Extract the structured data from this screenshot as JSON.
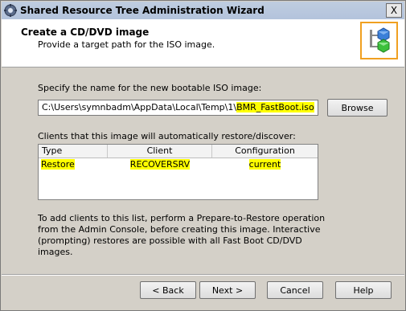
{
  "window": {
    "title": "Shared Resource Tree Administration Wizard",
    "close_label": "X"
  },
  "header": {
    "title": "Create a CD/DVD image",
    "subtitle": "Provide a target path for the ISO image."
  },
  "form": {
    "name_label": "Specify the name for the new bootable ISO image:",
    "path_prefix": "C:\\Users\\symnbadm\\AppData\\Local\\Temp\\1\\",
    "path_file": "BMR_FastBoot.iso",
    "browse_label": "Browse"
  },
  "clients": {
    "label": "Clients that this image will automatically restore/discover:",
    "columns": [
      "Type",
      "Client",
      "Configuration"
    ],
    "rows": [
      {
        "type": "Restore",
        "client": "RECOVERSRV",
        "configuration": "current"
      }
    ]
  },
  "info_text": "To add clients to this list, perform a Prepare-to-Restore operation from the Admin Console, before creating this image.  Interactive (prompting) restores are possible with all Fast Boot CD/DVD images.",
  "footer": {
    "back_label": "< Back",
    "next_label": "Next >",
    "cancel_label": "Cancel",
    "help_label": "Help"
  },
  "colors": {
    "highlight": "#ffff00",
    "logo_border": "#f0a020"
  }
}
